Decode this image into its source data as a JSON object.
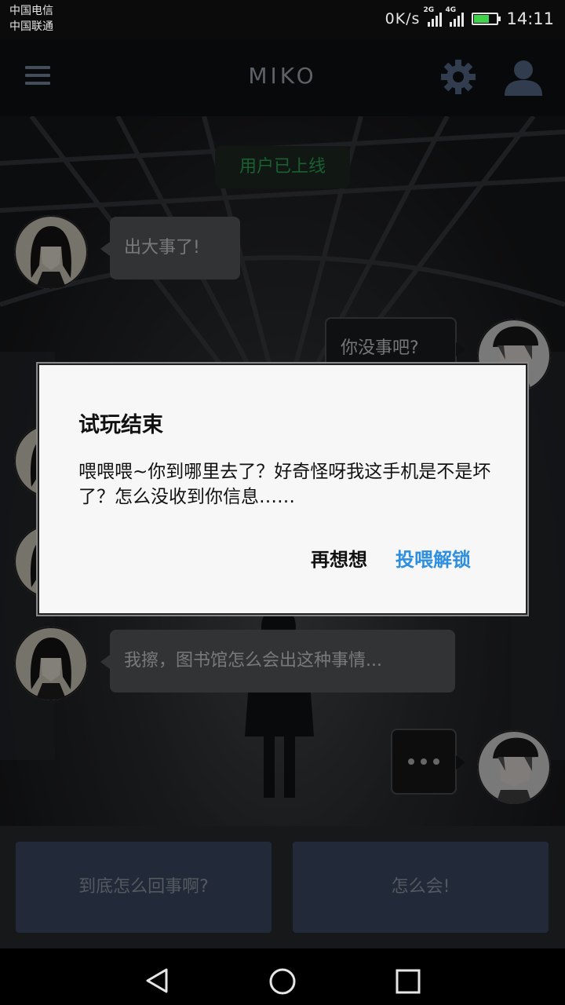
{
  "status_bar": {
    "carrier_1": "中国电信",
    "carrier_2": "中国联通",
    "net_speed": "0K/s",
    "sim1_network": "2G",
    "sim2_network": "4G",
    "battery_level": 0.62,
    "time": "14:11"
  },
  "app_bar": {
    "title": "MIKO",
    "icons": [
      "menu-icon",
      "gear-icon",
      "user-icon"
    ]
  },
  "chat": {
    "system_notice": "用户已上线",
    "messages": [
      {
        "from": "contact",
        "text": "出大事了!"
      },
      {
        "from": "me",
        "text": "你没事吧?"
      },
      {
        "from": "contact",
        "text": "我擦，图书馆怎么会出这种事情..."
      }
    ],
    "typing_indicator": "..."
  },
  "quick_replies": [
    "到底怎么回事啊?",
    "怎么会!"
  ],
  "dialog": {
    "title": "试玩结束",
    "message": "喂喂喂~你到哪里去了？好奇怪呀我这手机是不是坏了？怎么没收到你信息……",
    "cancel_label": "再想想",
    "confirm_label": "投喂解锁"
  },
  "nav_bar": {
    "icons": [
      "back-icon",
      "home-icon",
      "recents-icon"
    ]
  },
  "colors": {
    "accent": "#2e8fe0",
    "online_green": "#2fb05a",
    "reply_button": "#3e4c66"
  }
}
